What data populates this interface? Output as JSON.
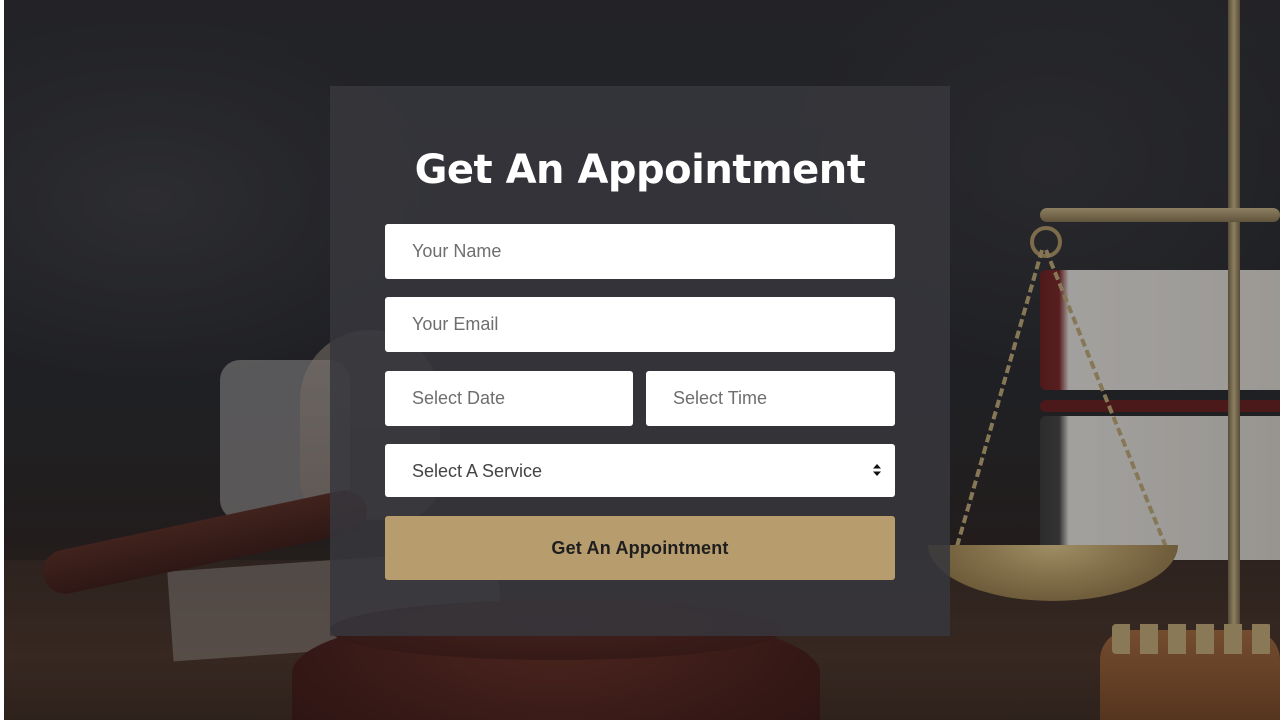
{
  "appointment_form": {
    "title": "Get An Appointment",
    "name_placeholder": "Your Name",
    "email_placeholder": "Your Email",
    "date_placeholder": "Select Date",
    "time_placeholder": "Select Time",
    "service_select": {
      "selected": "Select A Service"
    },
    "submit_label": "Get An Appointment"
  },
  "colors": {
    "card_background": "#37373c",
    "button_background": "#b79d6e",
    "title_text": "#ffffff"
  },
  "icons": {
    "select_arrows": "sort-arrows-icon"
  }
}
